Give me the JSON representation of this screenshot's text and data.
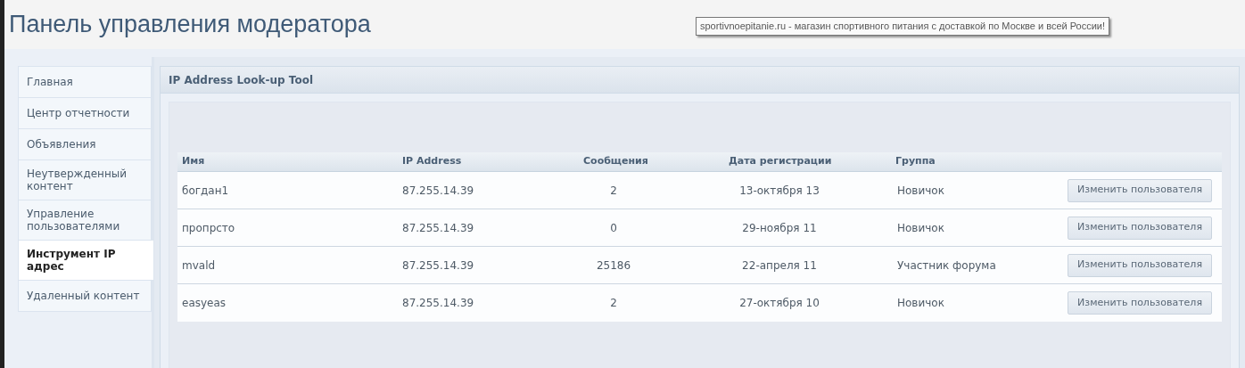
{
  "page_title": "Панель управления модератора",
  "tooltip": "sportivnoepitanie.ru - магазин спортивного питания с доставкой по Москве и всей России!",
  "sidebar": {
    "items": [
      {
        "label": "Главная",
        "selected": false
      },
      {
        "label": "Центр отчетности",
        "selected": false
      },
      {
        "label": "Объявления",
        "selected": false
      },
      {
        "label": "Неутвержденный контент",
        "selected": false
      },
      {
        "label": "Управление пользователями",
        "selected": false
      },
      {
        "label": "Инструмент IP адрес",
        "selected": true
      },
      {
        "label": "Удаленный контент",
        "selected": false
      }
    ]
  },
  "panel": {
    "title": "IP Address Look-up Tool",
    "table": {
      "columns": [
        "Имя",
        "IP Address",
        "Сообщения",
        "Дата регистрации",
        "Группа"
      ],
      "rows": [
        {
          "name": "богдан1",
          "ip": "87.255.14.39",
          "posts": "2",
          "registered": "13-октября 13",
          "group": "Новичок",
          "action": "Изменить пользователя"
        },
        {
          "name": "пропрсто",
          "ip": "87.255.14.39",
          "posts": "0",
          "registered": "29-ноября 11",
          "group": "Новичок",
          "action": "Изменить пользователя"
        },
        {
          "name": "mvald",
          "ip": "87.255.14.39",
          "posts": "25186",
          "registered": "22-апреля 11",
          "group": "Участник форума",
          "action": "Изменить пользователя"
        },
        {
          "name": "easyeas",
          "ip": "87.255.14.39",
          "posts": "2",
          "registered": "27-октября 10",
          "group": "Новичок",
          "action": "Изменить пользователя"
        }
      ]
    }
  }
}
